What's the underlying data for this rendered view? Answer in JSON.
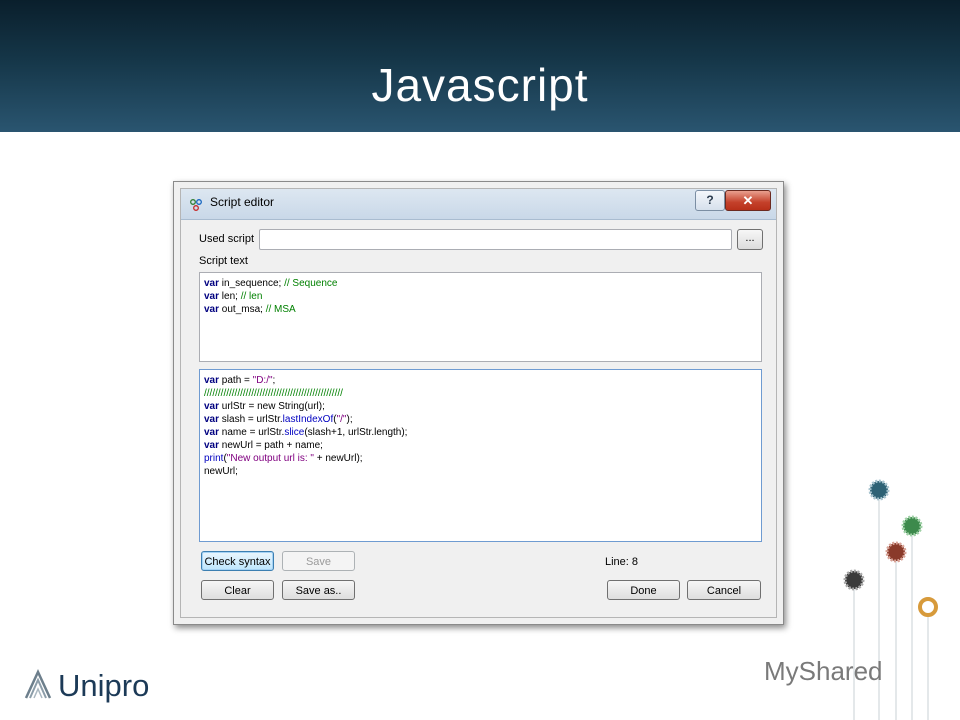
{
  "slide": {
    "title": "Javascript"
  },
  "dialog": {
    "title": "Script editor",
    "help_label": "?",
    "close_label": "✕",
    "used_script_label": "Used script",
    "used_script_value": "",
    "browse_label": "...",
    "script_text_label": "Script text",
    "line_status": "Line: 8",
    "buttons": {
      "check_syntax": "Check syntax",
      "save": "Save",
      "clear": "Clear",
      "save_as": "Save as..",
      "done": "Done",
      "cancel": "Cancel"
    }
  },
  "header_code": [
    [
      {
        "t": "var",
        "c": "kw"
      },
      {
        "t": " in_sequence; "
      },
      {
        "t": "// Sequence",
        "c": "cm"
      }
    ],
    [
      {
        "t": "var",
        "c": "kw"
      },
      {
        "t": " len; "
      },
      {
        "t": "// len",
        "c": "cm"
      }
    ],
    [
      {
        "t": "var",
        "c": "kw"
      },
      {
        "t": " out_msa; "
      },
      {
        "t": "// MSA",
        "c": "cm"
      }
    ]
  ],
  "body_code": [
    [
      {
        "t": "var",
        "c": "kw"
      },
      {
        "t": " path = "
      },
      {
        "t": "\"D:/\"",
        "c": "st"
      },
      {
        "t": ";"
      }
    ],
    [
      {
        "t": "//////////////////////////////////////////////////",
        "c": "cm"
      }
    ],
    [
      {
        "t": "var",
        "c": "kw"
      },
      {
        "t": " urlStr = new String(url);"
      }
    ],
    [
      {
        "t": "var",
        "c": "kw"
      },
      {
        "t": " slash = urlStr."
      },
      {
        "t": "lastIndexOf",
        "c": "fn"
      },
      {
        "t": "("
      },
      {
        "t": "\"/\"",
        "c": "st"
      },
      {
        "t": ");"
      }
    ],
    [
      {
        "t": "var",
        "c": "kw"
      },
      {
        "t": " name = urlStr."
      },
      {
        "t": "slice",
        "c": "fn"
      },
      {
        "t": "(slash+1, urlStr.length);"
      }
    ],
    [
      {
        "t": "var",
        "c": "kw"
      },
      {
        "t": " newUrl = path + name;"
      }
    ],
    [
      {
        "t": "print",
        "c": "fn"
      },
      {
        "t": "("
      },
      {
        "t": "\"New output url is: \"",
        "c": "st"
      },
      {
        "t": " + newUrl);"
      }
    ],
    [
      {
        "t": "newUrl;"
      }
    ]
  ],
  "branding": {
    "logo_text": "Unipro",
    "watermark_text": "MyShared"
  }
}
